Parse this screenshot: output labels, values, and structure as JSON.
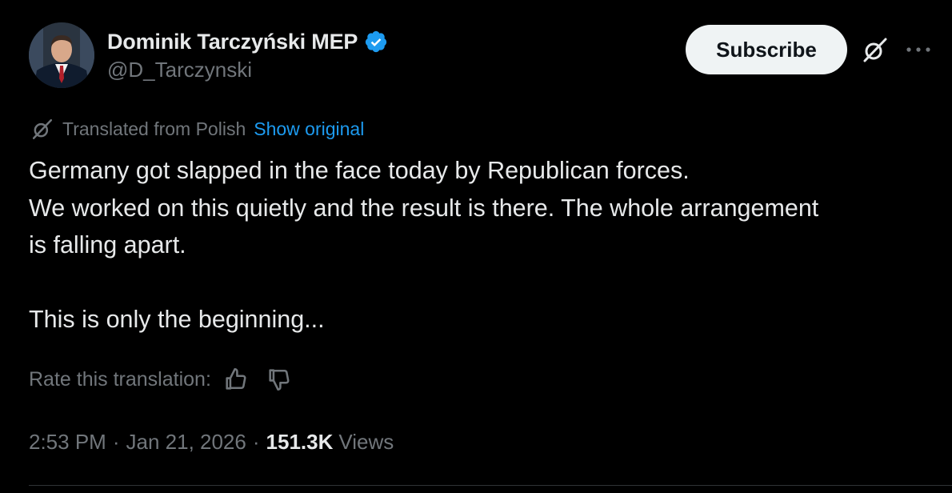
{
  "author": {
    "display_name": "Dominik Tarczyński MEP",
    "handle": "@D_Tarczynski",
    "verified": true,
    "verified_badge_color": "#1d9bf0"
  },
  "actions": {
    "subscribe_label": "Subscribe",
    "grok_icon": "grok-icon",
    "more_icon": "more-horizontal-icon"
  },
  "translation": {
    "icon": "grok-icon",
    "label": "Translated from Polish",
    "show_original": "Show original"
  },
  "post": {
    "lines": [
      "Germany got slapped in the face today by Republican forces.",
      "We worked on this quietly and the result is there. The whole arrangement",
      "is falling apart.",
      "",
      "This is only the beginning..."
    ]
  },
  "rating": {
    "label": "Rate this translation:",
    "thumbs_up_icon": "thumbs-up-icon",
    "thumbs_down_icon": "thumbs-down-icon"
  },
  "meta": {
    "time": "2:53 PM",
    "separator": "·",
    "date": "Jan 21, 2026",
    "views_count": "151.3K",
    "views_label": "Views"
  },
  "colors": {
    "background": "#000000",
    "text_primary": "#e7e9ea",
    "text_secondary": "#71767b",
    "link": "#1d9bf0",
    "button_bg": "#eff3f4",
    "divider": "#2f3336"
  }
}
